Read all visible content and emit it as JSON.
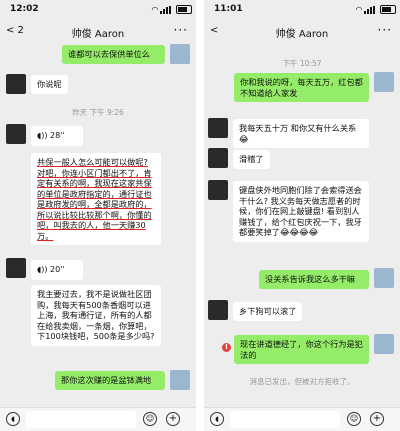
{
  "left": {
    "status_time": "12:02",
    "title": "帅俊 Aaron",
    "back": "< 2",
    "more": "···",
    "messages": [
      {
        "text": "谁都可以去保供单位么",
        "from": "me"
      },
      {
        "text": "你说呢",
        "from": "them"
      },
      {
        "time": "昨天 下午 9:26"
      },
      {
        "voice": "28''",
        "from": "them"
      },
      {
        "text": "共保一般人怎么可能可以做呢? 对吧，你连小区门都出不了，肯定有关系的啊，我现在这家共保的单位是政府指定的，通行证也是政府发的啊，全都是政府的，所以说比较比较那个啊，你懂的吧，叫我去的人，他一天赚30万。",
        "from": "them"
      },
      {
        "voice": "20''",
        "from": "them"
      },
      {
        "text": "我主要过去，我不是说做社区团购，我每天有500条香烟可以进上海，我有通行证，所有的人都在给我卖烟，一条烟，你算吧，下100块钱吧，500条是多少吗?",
        "from": "them"
      },
      {
        "text": "那你这次赚的是盆钵满地",
        "from": "me"
      }
    ]
  },
  "right": {
    "status_time": "11:01",
    "title": "帅俊 Aaron",
    "back": "<",
    "more": "···",
    "messages": [
      {
        "time": "下午 10:57"
      },
      {
        "text": "你和我说的呀，每天五万，红包都不知道给人家发",
        "from": "me"
      },
      {
        "text": "我每天五十万 和你又有什么关系😂",
        "from": "them"
      },
      {
        "text": "滑稽了",
        "from": "them"
      },
      {
        "text": "键盘侠外地同胞们除了会索得送会干什么? 我义务每天做志愿者的时候，你们在网上敲键盘! 看到别人赚钱了，给个红包庆祝一下，我牙都要笑掉了😂😂😂😂",
        "from": "them"
      },
      {
        "text": "没关系告诉我这么多干嘛",
        "from": "me"
      },
      {
        "text": "乡下狗可以滚了",
        "from": "them"
      },
      {
        "text": "现在讲道德经了，你这个行为是犯法的",
        "from": "me",
        "error": "!"
      },
      {
        "system": "消息已发出，但被对方拒收了。"
      }
    ]
  }
}
